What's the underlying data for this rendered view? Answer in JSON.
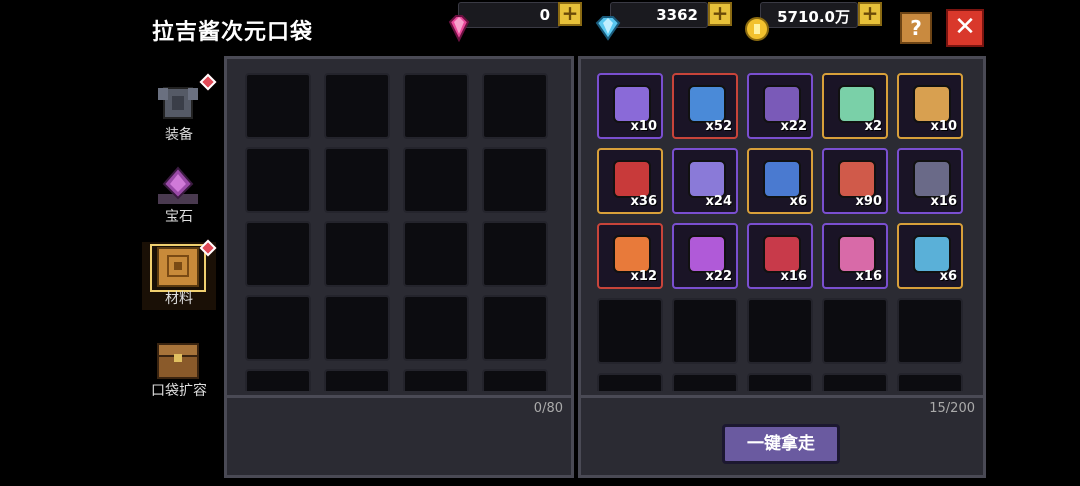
{
  "title": "拉吉酱次元口袋",
  "currencies": [
    {
      "name": "pink-gem",
      "value": "0",
      "color": "#e9489a"
    },
    {
      "name": "blue-diamond",
      "value": "3362",
      "color": "#5ac8f0"
    },
    {
      "name": "gold-coin",
      "value": "5710.0万",
      "color": "#f2c12e"
    }
  ],
  "buttons": {
    "help": "?",
    "close": "✕",
    "take_all": "一键拿走"
  },
  "sidebar": [
    {
      "label": "装备",
      "icon": "armor-icon",
      "badge": true,
      "active": false
    },
    {
      "label": "宝石",
      "icon": "gem-icon",
      "badge": false,
      "active": false
    },
    {
      "label": "材料",
      "icon": "material-icon",
      "badge": true,
      "active": true
    },
    {
      "label": "口袋扩容",
      "icon": "chest-icon",
      "badge": false,
      "active": false
    }
  ],
  "left_panel": {
    "count": "0/80"
  },
  "right_panel": {
    "count": "15/200",
    "items": [
      {
        "qty": "x10",
        "rarity": "#7a4fd0",
        "color": "#8a6ad8"
      },
      {
        "qty": "x52",
        "rarity": "#c8443a",
        "color": "#4a8ad8"
      },
      {
        "qty": "x22",
        "rarity": "#7a4fd0",
        "color": "#7a5ab8"
      },
      {
        "qty": "x2",
        "rarity": "#d8a03a",
        "color": "#7ad0a8"
      },
      {
        "qty": "x10",
        "rarity": "#d8a03a",
        "color": "#d8a050"
      },
      {
        "qty": "x36",
        "rarity": "#d8a03a",
        "color": "#c83a3a"
      },
      {
        "qty": "x24",
        "rarity": "#7a4fd0",
        "color": "#8a7ad8"
      },
      {
        "qty": "x6",
        "rarity": "#d8a03a",
        "color": "#4a7ad0"
      },
      {
        "qty": "x90",
        "rarity": "#7a4fd0",
        "color": "#d05a4a"
      },
      {
        "qty": "x16",
        "rarity": "#7a4fd0",
        "color": "#6a6a88"
      },
      {
        "qty": "x12",
        "rarity": "#c8443a",
        "color": "#e87a3a"
      },
      {
        "qty": "x22",
        "rarity": "#7a4fd0",
        "color": "#b05ad8"
      },
      {
        "qty": "x16",
        "rarity": "#7a4fd0",
        "color": "#c83a4a"
      },
      {
        "qty": "x16",
        "rarity": "#7a4fd0",
        "color": "#d86aa8"
      },
      {
        "qty": "x6",
        "rarity": "#d8a03a",
        "color": "#5ab0d8"
      }
    ]
  }
}
